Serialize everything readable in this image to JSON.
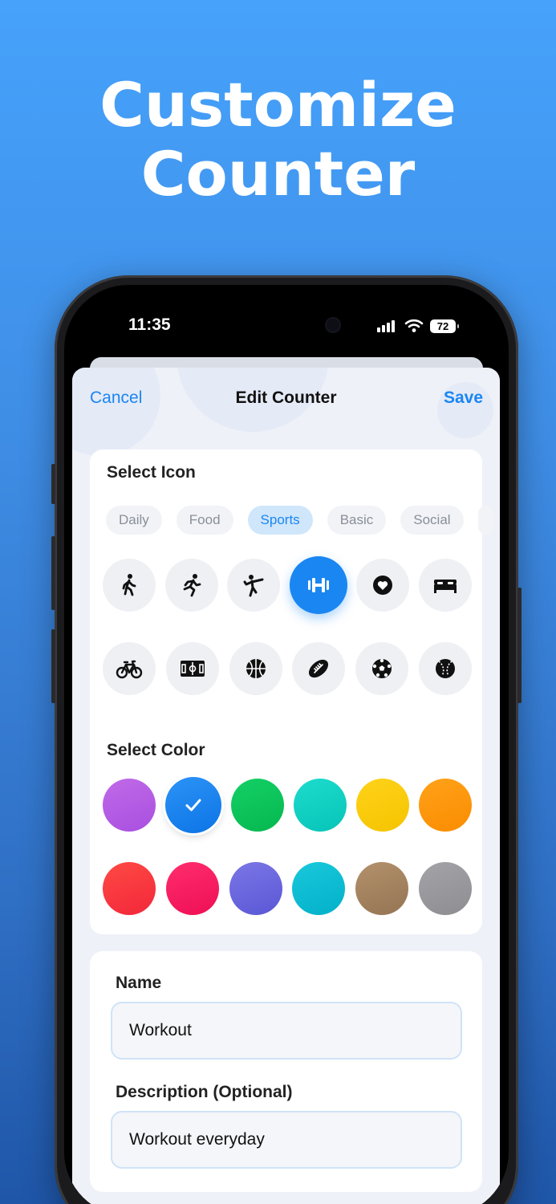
{
  "promo": {
    "line1": "Customize",
    "line2": "Counter"
  },
  "status_bar": {
    "time": "11:35",
    "battery": "72"
  },
  "nav": {
    "cancel": "Cancel",
    "title": "Edit Counter",
    "save": "Save"
  },
  "icon_section": {
    "title": "Select Icon",
    "categories": [
      "Daily",
      "Food",
      "Sports",
      "Basic",
      "Social"
    ],
    "selected_category": "Sports",
    "icons_row1": [
      "figure-walk-icon",
      "figure-run-icon",
      "martial-arts-kick-icon",
      "dumbbell-icon",
      "heart-icon",
      "bed-icon"
    ],
    "icons_row2": [
      "bicycle-icon",
      "soccer-field-icon",
      "basketball-icon",
      "football-icon",
      "soccer-ball-icon",
      "baseball-icon"
    ],
    "selected_icon": "dumbbell-icon"
  },
  "color_section": {
    "title": "Select Color",
    "colors_row1": [
      "#b45ee6",
      "#1583f0",
      "#0ac85a",
      "#10d2c4",
      "#ffcc00",
      "#ff9800"
    ],
    "colors_row2": [
      "#ff3b3f",
      "#ff1f63",
      "#6b6be0",
      "#0fbfd6",
      "#a88660",
      "#9a9a9e"
    ],
    "selected_color": "#1583f0"
  },
  "form": {
    "name_label": "Name",
    "name_value": "Workout",
    "description_label": "Description (Optional)",
    "description_value": "Workout everyday"
  }
}
